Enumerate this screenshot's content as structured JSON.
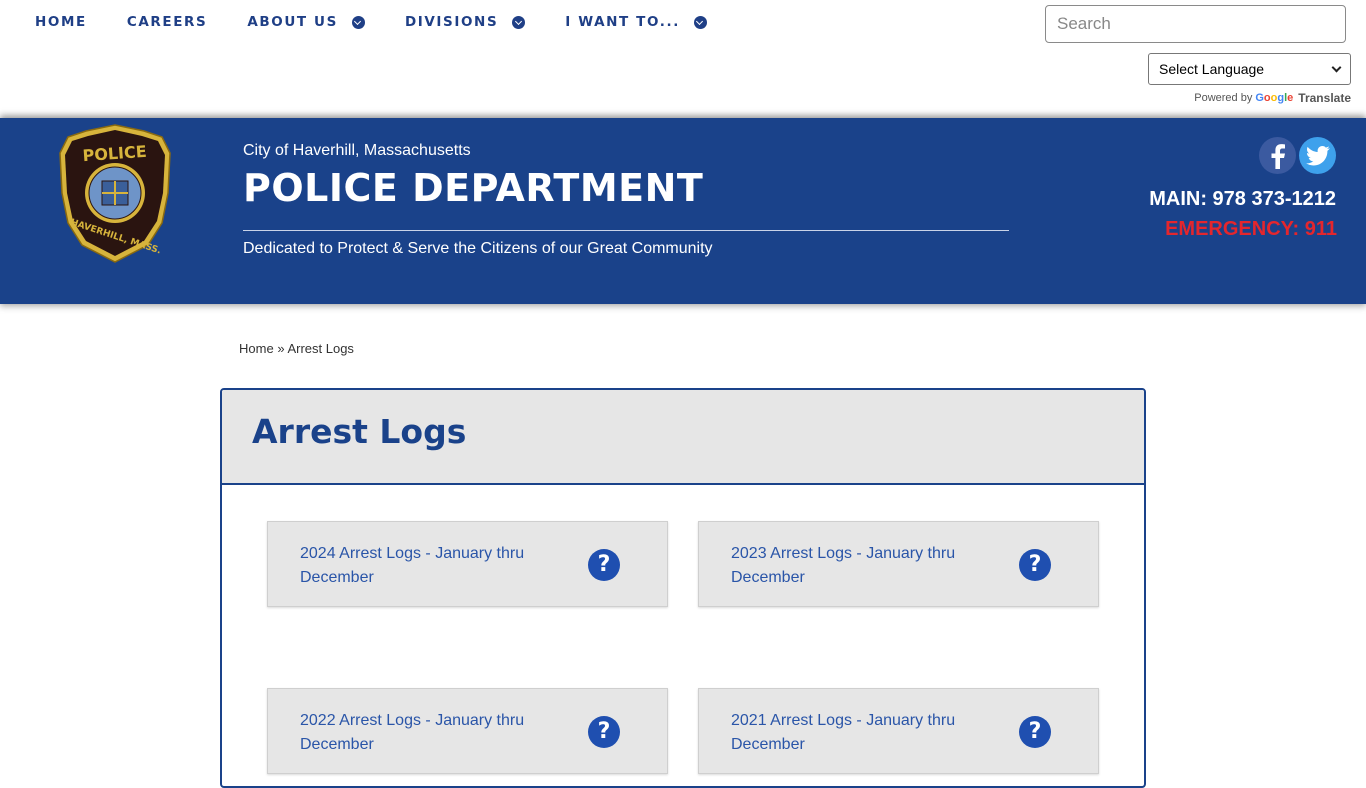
{
  "nav": {
    "items": [
      {
        "label": "HOME",
        "dropdown": false
      },
      {
        "label": "CAREERS",
        "dropdown": false
      },
      {
        "label": "ABOUT US",
        "dropdown": true
      },
      {
        "label": "DIVISIONS",
        "dropdown": true
      },
      {
        "label": "I WANT TO...",
        "dropdown": true
      }
    ]
  },
  "search": {
    "placeholder": "Search",
    "value": ""
  },
  "translate": {
    "select_label": "Select Language",
    "powered_by": "Powered by",
    "google": "Google",
    "translate_label": "Translate"
  },
  "header": {
    "city": "City of Haverhill, Massachusetts",
    "title": "POLICE DEPARTMENT",
    "motto": "Dedicated to Protect & Serve the Citizens of our Great Community",
    "badge_top": "POLICE",
    "badge_bottom": "HAVERHILL, MASS.",
    "main_phone": "MAIN: 978 373-1212",
    "emergency": "EMERGENCY: 911"
  },
  "social": {
    "facebook_icon": "facebook-icon",
    "twitter_icon": "twitter-icon"
  },
  "breadcrumb": {
    "home": "Home",
    "separator": "»",
    "current": "Arrest Logs"
  },
  "page": {
    "title": "Arrest Logs",
    "cards": [
      {
        "label": "2024 Arrest Logs - January thru December",
        "icon": "question-icon"
      },
      {
        "label": "2023 Arrest Logs - January thru December",
        "icon": "question-icon"
      },
      {
        "label": "2022 Arrest Logs - January thru December",
        "icon": "question-icon"
      },
      {
        "label": "2021 Arrest Logs - January thru December",
        "icon": "question-icon"
      }
    ]
  },
  "colors": {
    "brand": "#1a428a",
    "link": "#2a55a8",
    "emergency": "#e4262d",
    "panel_bg": "#e6e6e6"
  }
}
